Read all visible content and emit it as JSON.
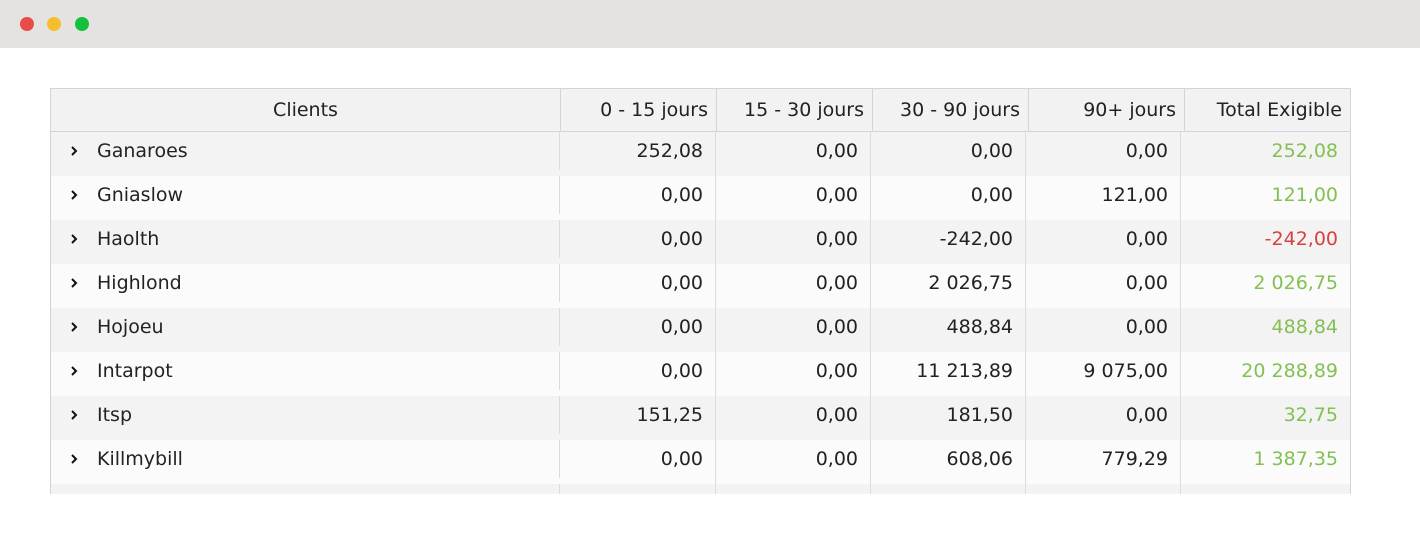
{
  "window": {
    "controls": [
      "close",
      "minimize",
      "maximize"
    ]
  },
  "colors": {
    "positive_total": "#84c051",
    "negative_total": "#d8413e",
    "header_bg": "#f2f2f2"
  },
  "table": {
    "headers": [
      "Clients",
      "0 - 15 jours",
      "15 - 30 jours",
      "30 - 90 jours",
      "90+ jours",
      "Total Exigible"
    ],
    "rows": [
      {
        "client": "Ganaroes",
        "d0_15": "252,08",
        "d15_30": "0,00",
        "d30_90": "0,00",
        "d90": "0,00",
        "total": "252,08",
        "sign": "pos"
      },
      {
        "client": "Gniaslow",
        "d0_15": "0,00",
        "d15_30": "0,00",
        "d30_90": "0,00",
        "d90": "121,00",
        "total": "121,00",
        "sign": "pos"
      },
      {
        "client": "Haolth",
        "d0_15": "0,00",
        "d15_30": "0,00",
        "d30_90": "-242,00",
        "d90": "0,00",
        "total": "-242,00",
        "sign": "neg"
      },
      {
        "client": "Highlond",
        "d0_15": "0,00",
        "d15_30": "0,00",
        "d30_90": "2 026,75",
        "d90": "0,00",
        "total": "2 026,75",
        "sign": "pos"
      },
      {
        "client": "Hojoeu",
        "d0_15": "0,00",
        "d15_30": "0,00",
        "d30_90": "488,84",
        "d90": "0,00",
        "total": "488,84",
        "sign": "pos"
      },
      {
        "client": "Intarpot",
        "d0_15": "0,00",
        "d15_30": "0,00",
        "d30_90": "11 213,89",
        "d90": "9 075,00",
        "total": "20 288,89",
        "sign": "pos"
      },
      {
        "client": "Itsp",
        "d0_15": "151,25",
        "d15_30": "0,00",
        "d30_90": "181,50",
        "d90": "0,00",
        "total": "32,75",
        "sign": "pos"
      },
      {
        "client": "Killmybill",
        "d0_15": "0,00",
        "d15_30": "0,00",
        "d30_90": "608,06",
        "d90": "779,29",
        "total": "1 387,35",
        "sign": "pos"
      },
      {
        "client": "",
        "d0_15": "",
        "d15_30": "",
        "d30_90": "",
        "d90": "",
        "total": "",
        "sign": "pos"
      }
    ]
  }
}
